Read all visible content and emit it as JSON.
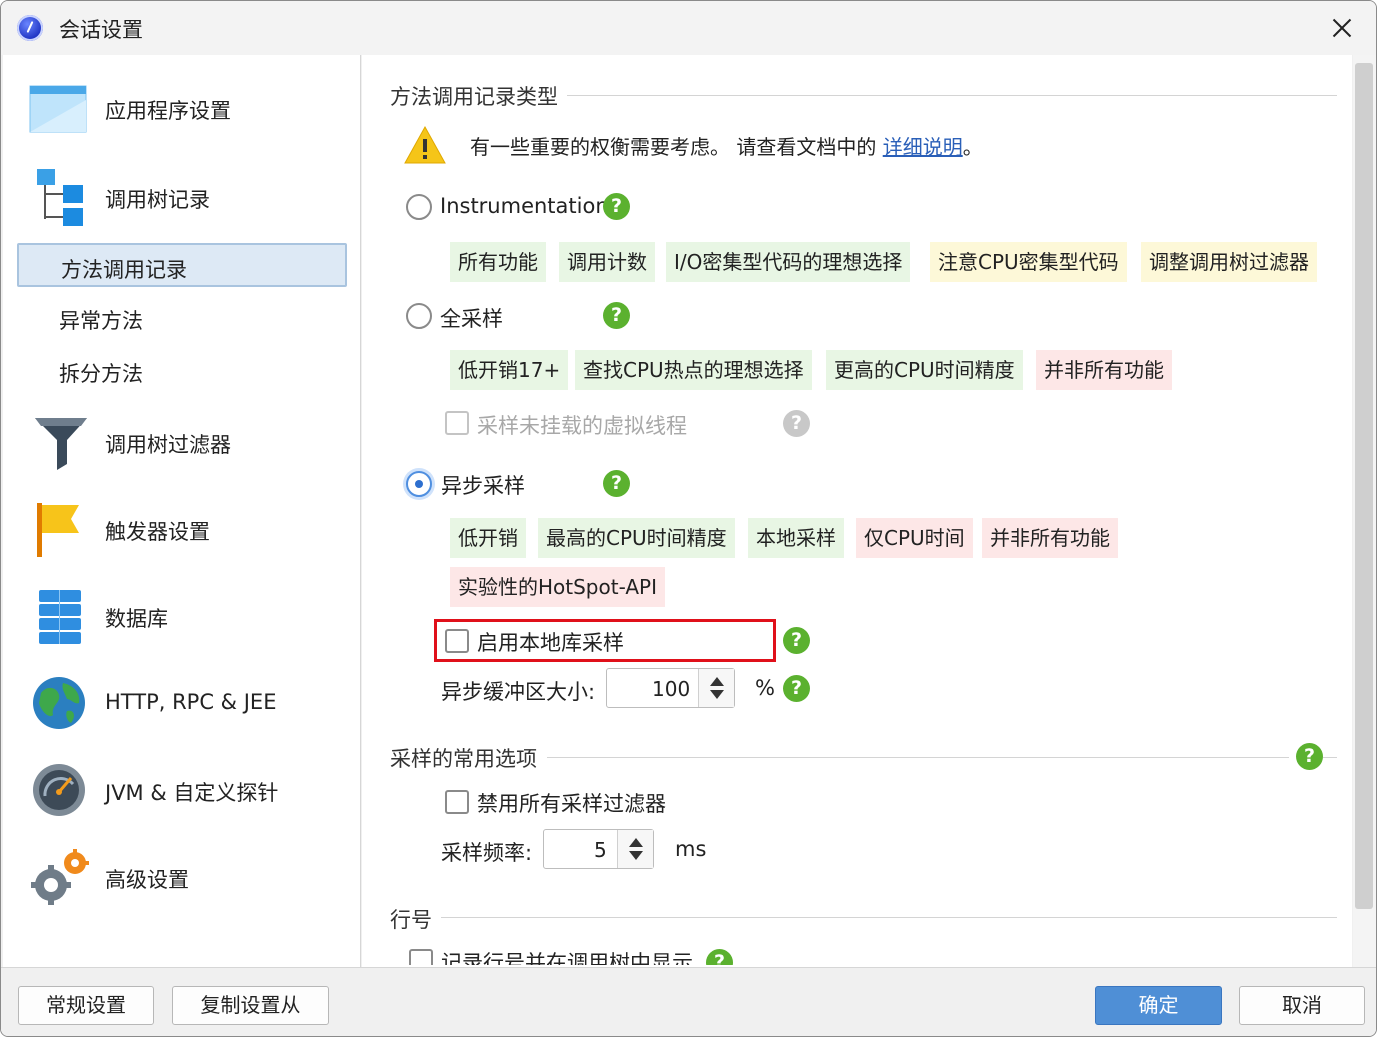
{
  "window": {
    "title": "会话设置"
  },
  "sidebar": {
    "items": [
      {
        "label": "应用程序设置",
        "icon": "application-window-icon"
      },
      {
        "label": "调用树记录",
        "icon": "call-tree-icon"
      },
      {
        "label": "方法调用记录",
        "selected": true
      },
      {
        "label": "异常方法"
      },
      {
        "label": "拆分方法"
      },
      {
        "label": "调用树过滤器",
        "icon": "funnel-icon"
      },
      {
        "label": "触发器设置",
        "icon": "flag-icon"
      },
      {
        "label": "数据库",
        "icon": "database-icon"
      },
      {
        "label": "HTTP, RPC & JEE",
        "icon": "globe-icon"
      },
      {
        "label": "JVM & 自定义探针",
        "icon": "gauge-icon"
      },
      {
        "label": "高级设置",
        "icon": "gears-icon"
      }
    ]
  },
  "method_recording": {
    "section_title": "方法调用记录类型",
    "info_text": "有一些重要的权衡需要考虑。 请查看文档中的 ",
    "info_link": "详细说明",
    "info_suffix": "。",
    "instrumentation": {
      "label": "Instrumentation",
      "help": "?",
      "tags": [
        {
          "text": "所有功能",
          "kind": "good"
        },
        {
          "text": "调用计数",
          "kind": "good"
        },
        {
          "text": "I/O密集型代码的理想选择",
          "kind": "good"
        },
        {
          "text": "注意CPU密集型代码",
          "kind": "warn"
        },
        {
          "text": "调整调用树过滤器",
          "kind": "warn"
        }
      ]
    },
    "full_sampling": {
      "label": "全采样",
      "help": "?",
      "tags": [
        {
          "text": "低开销17+",
          "kind": "good"
        },
        {
          "text": "查找CPU热点的理想选择",
          "kind": "good"
        },
        {
          "text": "更高的CPU时间精度",
          "kind": "good"
        },
        {
          "text": "并非所有功能",
          "kind": "bad"
        }
      ],
      "sub_option": "采样未挂载的虚拟线程"
    },
    "async_sampling": {
      "label": "异步采样",
      "selected": true,
      "help": "?",
      "tags": [
        {
          "text": "低开销",
          "kind": "good"
        },
        {
          "text": "最高的CPU时间精度",
          "kind": "good"
        },
        {
          "text": "本地采样",
          "kind": "good"
        },
        {
          "text": "仅CPU时间",
          "kind": "bad"
        },
        {
          "text": "并非所有功能",
          "kind": "bad"
        },
        {
          "text": "实验性的HotSpot-API",
          "kind": "bad"
        }
      ],
      "native_sampling_label": "启用本地库采样",
      "buffer_label": "异步缓冲区大小:",
      "buffer_value": "100",
      "buffer_unit": "%"
    }
  },
  "sampling_options": {
    "section_title": "采样的常用选项",
    "disable_filters_label": "禁用所有采样过滤器",
    "frequency_label": "采样频率:",
    "frequency_value": "5",
    "frequency_unit": "ms"
  },
  "line_numbers": {
    "section_title": "行号",
    "option_label": "记录行号并在调用树中显示"
  },
  "buttons": {
    "general": "常规设置",
    "copy_from": "复制设置从",
    "ok": "确定",
    "cancel": "取消"
  },
  "colors": {
    "accent": "#4f8fd6",
    "good_tag": "#e8f6e4",
    "warn_tag": "#fdf8d8",
    "bad_tag": "#fde7e7",
    "help_green": "#5bb12f",
    "highlight": "#e0101a"
  }
}
